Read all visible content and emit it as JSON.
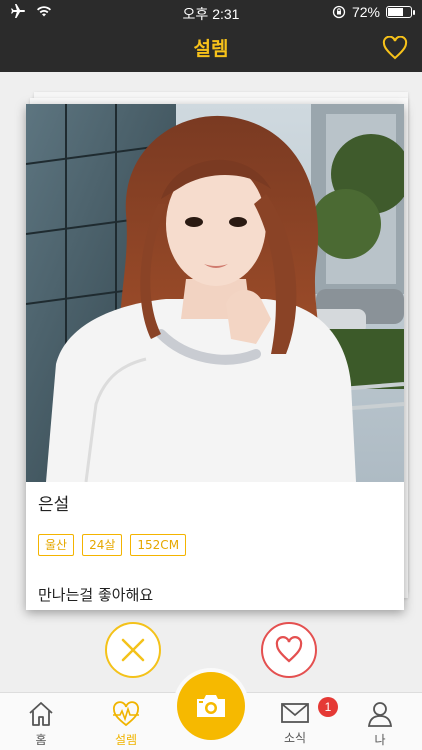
{
  "status_bar": {
    "time": "오후 2:31",
    "battery_text": "72%",
    "battery_level": 0.72
  },
  "header": {
    "title": "설렘",
    "right_icon": "heart-outline-icon"
  },
  "card": {
    "name": "은설",
    "tags": [
      "울산",
      "24살",
      "152CM"
    ],
    "bio": "만나는걸 좋아해요"
  },
  "actions": {
    "dislike_icon": "close-icon",
    "like_icon": "heart-outline-icon"
  },
  "tabbar": {
    "tabs": [
      {
        "label": "홈",
        "icon": "home-icon"
      },
      {
        "label": "설렘",
        "icon": "heartbeat-icon",
        "active": true
      },
      {
        "label": "",
        "icon": "camera-icon"
      },
      {
        "label": "소식",
        "icon": "mail-icon",
        "badge": "1"
      },
      {
        "label": "나",
        "icon": "user-icon"
      }
    ]
  },
  "colors": {
    "accent": "#f6b900",
    "header_bg": "#2b2b2b",
    "like": "#e45050"
  }
}
